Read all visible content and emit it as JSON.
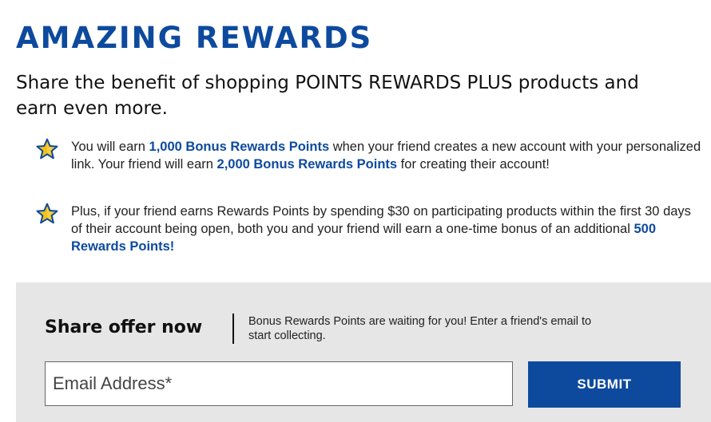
{
  "header": {
    "title": "AMAZING REWARDS",
    "subtitle": "Share the benefit of shopping POINTS REWARDS PLUS products and earn even more."
  },
  "benefits": [
    {
      "icon": "star-icon",
      "parts": [
        {
          "text": "You will earn ",
          "highlight": false
        },
        {
          "text": "1,000 Bonus Rewards Points",
          "highlight": true
        },
        {
          "text": " when your friend creates a new account with your personalized link. Your friend will earn ",
          "highlight": false
        },
        {
          "text": "2,000 Bonus Rewards Points",
          "highlight": true
        },
        {
          "text": " for creating their account!",
          "highlight": false
        }
      ]
    },
    {
      "icon": "star-icon",
      "parts": [
        {
          "text": "Plus, if your friend earns Rewards Points by spending $30 on participating products within the first 30 days of their account being open, both you and your friend will earn a one-time bonus of an additional ",
          "highlight": false
        },
        {
          "text": "500 Rewards Points!",
          "highlight": true
        }
      ]
    }
  ],
  "share": {
    "heading": "Share offer now",
    "description": "Bonus Rewards Points are waiting for you! Enter a friend's email to start collecting.",
    "email_placeholder": "Email Address*",
    "email_value": "",
    "submit_label": "SUBMIT"
  },
  "colors": {
    "brand_blue": "#0d4a9e",
    "star_gold": "#f2c21b",
    "panel_gray": "#e6e6e6"
  }
}
